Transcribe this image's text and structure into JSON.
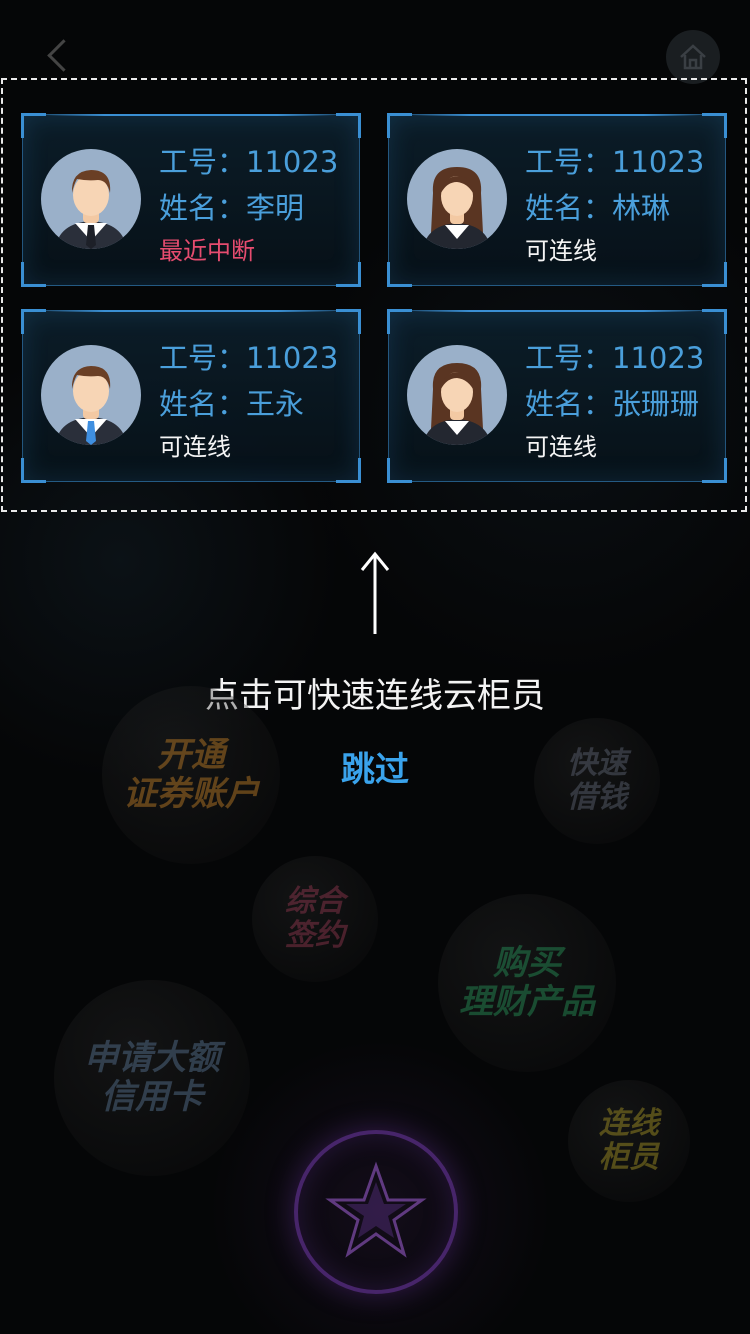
{
  "agents": [
    {
      "id_label": "工号：",
      "id_value": "11023",
      "name_label": "姓名：",
      "name_value": "李明",
      "status": "最近中断",
      "gender": "male",
      "tie": "dark"
    },
    {
      "id_label": "工号：",
      "id_value": "11023",
      "name_label": "姓名：",
      "name_value": "林琳",
      "status": "可连线",
      "gender": "female",
      "tie": "none"
    },
    {
      "id_label": "工号：",
      "id_value": "11023",
      "name_label": "姓名：",
      "name_value": "王永",
      "status": "可连线",
      "gender": "male",
      "tie": "blue"
    },
    {
      "id_label": "工号：",
      "id_value": "11023",
      "name_label": "姓名：",
      "name_value": "张珊珊",
      "status": "可连线",
      "gender": "female",
      "tie": "none"
    }
  ],
  "hint": "点击可快速连线云柜员",
  "skip_label": "跳过",
  "bubbles": {
    "open_account": [
      "开通",
      "证券账户"
    ],
    "quick_loan": [
      "快速",
      "借钱"
    ],
    "sign": [
      "综合",
      "签约"
    ],
    "buy_products": [
      "购买",
      "理财产品"
    ],
    "credit_card": [
      "申请大额",
      "信用卡"
    ],
    "connect_teller": [
      "连线",
      "柜员"
    ]
  },
  "colors": {
    "accent": "#3a8fd3",
    "label": "#4a9fdb",
    "warn": "#e64c6f",
    "skip": "#3aa3ec"
  }
}
